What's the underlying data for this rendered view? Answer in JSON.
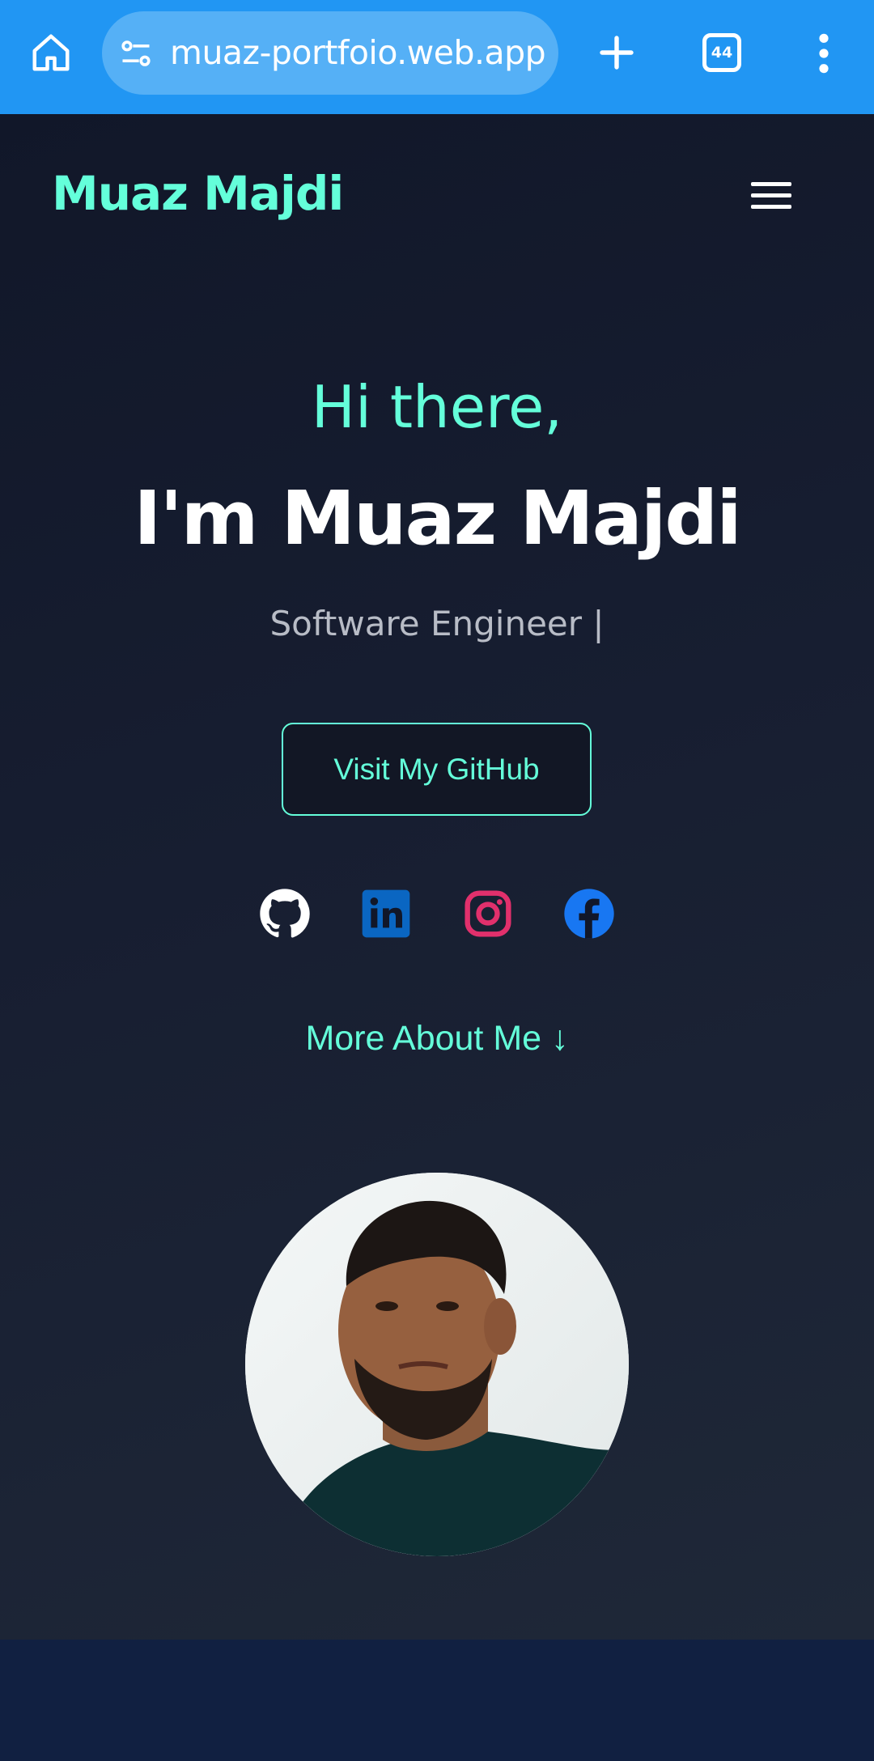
{
  "browser": {
    "url": "muaz-portfoio.web.app",
    "tab_count": "44",
    "theme_color": "#2196f3"
  },
  "site": {
    "logo_text": "Muaz Majdi",
    "accent": "#64ffda"
  },
  "hero": {
    "greeting": "Hi there,",
    "headline": "I'm Muaz Majdi",
    "subtitle": "Software Engineer |",
    "cta_label": "Visit My GitHub",
    "more_link": "More About Me ↓"
  },
  "socials": [
    {
      "name": "github-icon",
      "color": "#ffffff"
    },
    {
      "name": "linkedin-icon",
      "color": "#0a66c2"
    },
    {
      "name": "instagram-icon",
      "color": "#e1306c"
    },
    {
      "name": "facebook-icon",
      "color": "#1877f2"
    }
  ]
}
